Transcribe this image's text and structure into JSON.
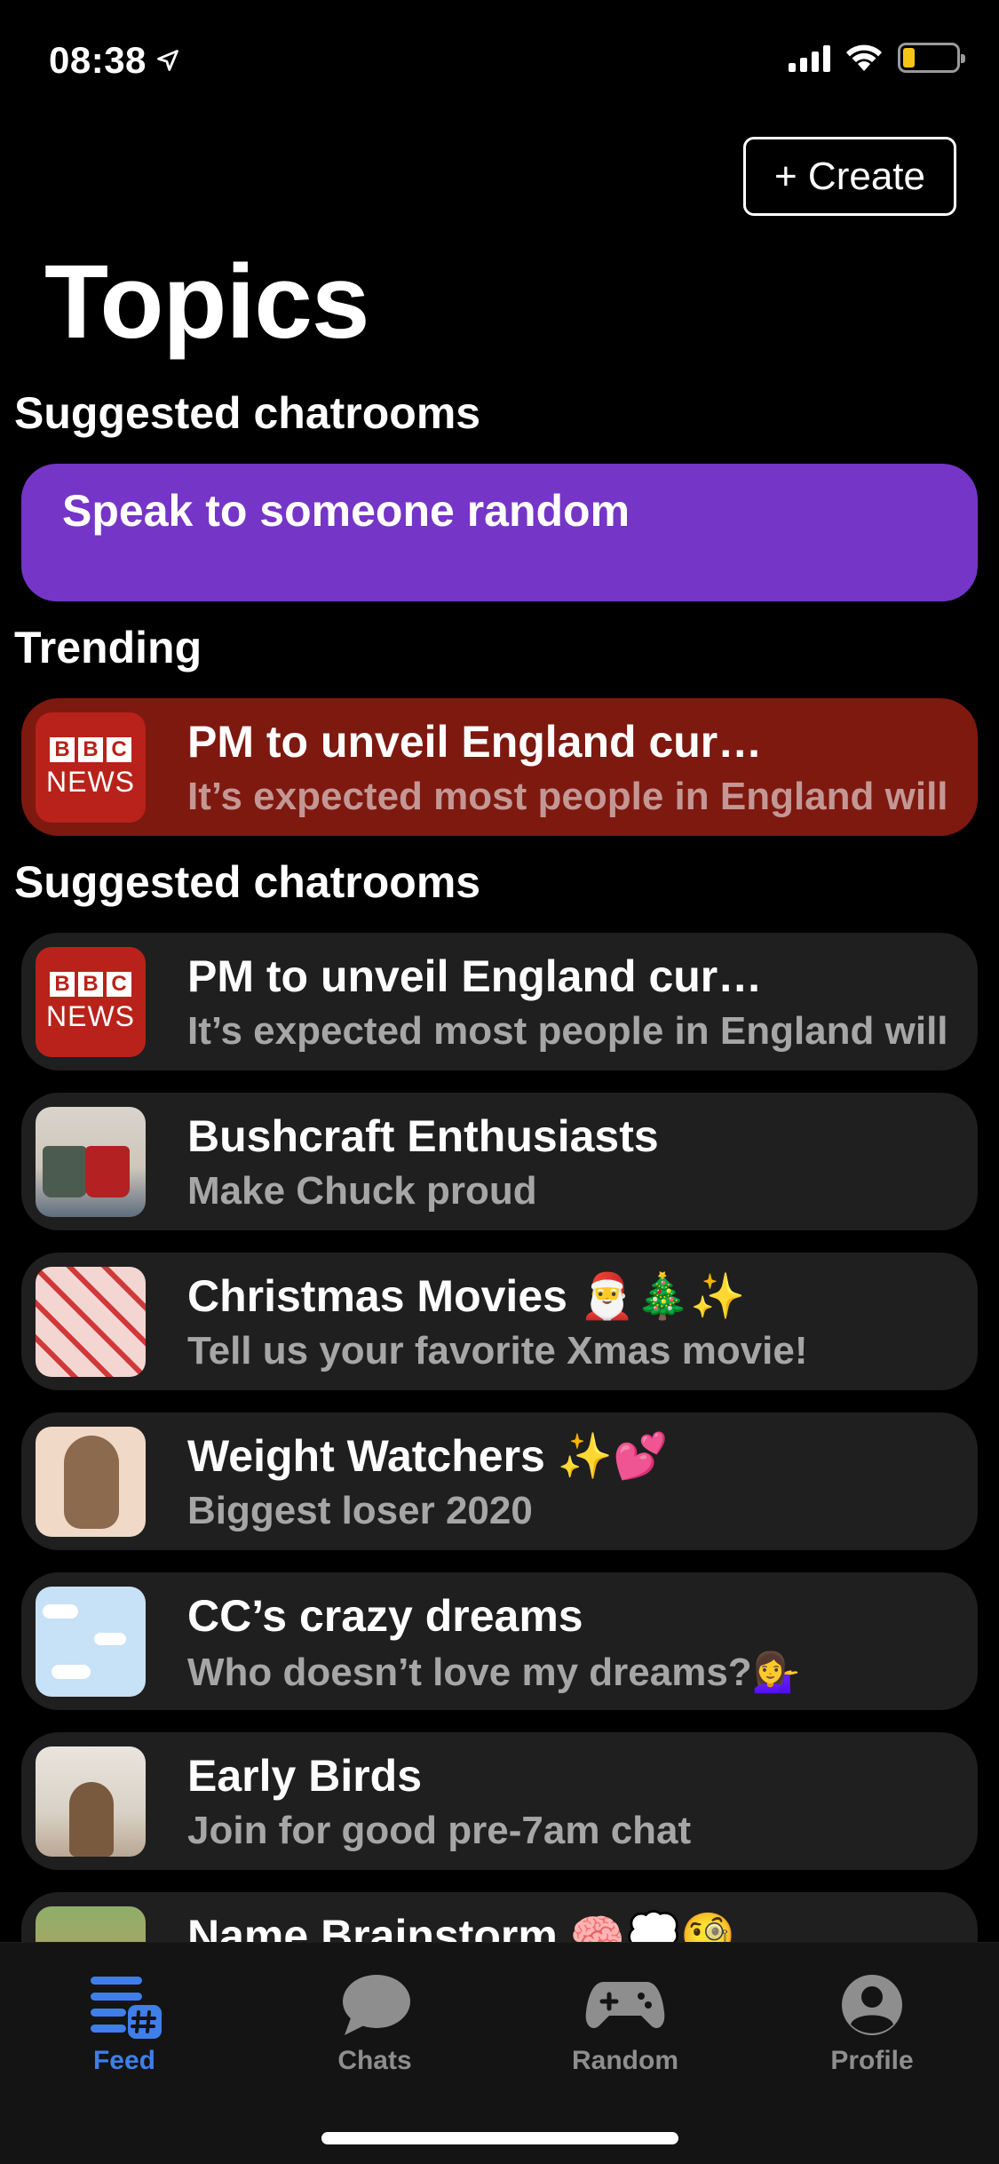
{
  "status": {
    "time": "08:38"
  },
  "header": {
    "create_label": "+ Create",
    "title": "Topics"
  },
  "sections": {
    "suggested_1": "Suggested chatrooms",
    "trending": "Trending",
    "suggested_2": "Suggested chatrooms"
  },
  "random_card": {
    "label": "Speak to someone random"
  },
  "trending_item": {
    "title": "PM to unveil England cur…",
    "subtitle": "It’s expected most people in England will",
    "logo_top": [
      "B",
      "B",
      "C"
    ],
    "logo_bottom": "NEWS"
  },
  "chatrooms": [
    {
      "title": "PM to unveil England cur…",
      "subtitle": "It’s expected most people in England will",
      "thumb": "bbc-news-logo"
    },
    {
      "title": "Bushcraft Enthusiasts",
      "subtitle": "Make Chuck proud",
      "thumb": "camp-mugs-photo"
    },
    {
      "title": "Christmas Movies 🎅🎄✨",
      "subtitle": "Tell us your favorite Xmas movie!",
      "thumb": "candy-cane-pattern"
    },
    {
      "title": "Weight Watchers ✨💕",
      "subtitle": "Biggest loser 2020",
      "thumb": "braid-hair-illustration"
    },
    {
      "title": "CC’s crazy dreams",
      "subtitle": "Who doesn’t love my dreams?💁‍♀️",
      "thumb": "cloud-sky-pattern"
    },
    {
      "title": "Early Birds",
      "subtitle": "Join for good pre-7am chat",
      "thumb": "woman-coffee-photo"
    },
    {
      "title": "Name Brainstorm 🧠💭🧐",
      "subtitle": "",
      "thumb": "dog-photo"
    }
  ],
  "tabs": [
    {
      "label": "Feed",
      "icon": "feed-icon",
      "active": true
    },
    {
      "label": "Chats",
      "icon": "chat-bubble-icon",
      "active": false
    },
    {
      "label": "Random",
      "icon": "gamepad-icon",
      "active": false
    },
    {
      "label": "Profile",
      "icon": "profile-icon",
      "active": false
    }
  ],
  "colors": {
    "background": "#000000",
    "accent_purple": "#7535c6",
    "trending_red": "#7e1910",
    "row_bg": "#1f1f1f",
    "active_tab": "#3e7fe8",
    "inactive_tab": "#8e8e8e",
    "battery": "#f5c518"
  }
}
